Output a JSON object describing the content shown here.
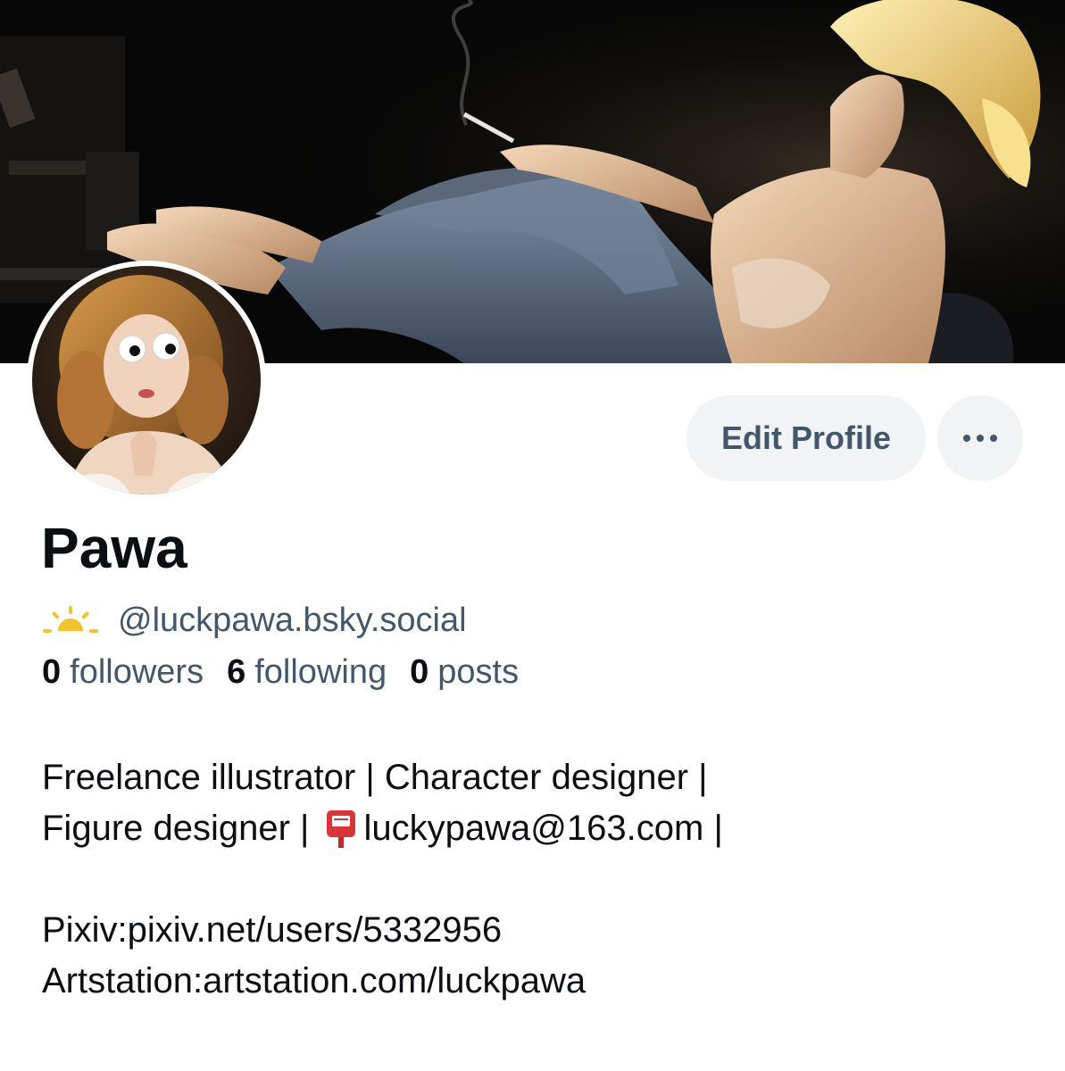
{
  "banner": {
    "icon": "anime-illustration-banner-image"
  },
  "avatar": {
    "icon": "painted-child-portrait-googly-eyes-avatar"
  },
  "actions": {
    "edit_profile_label": "Edit Profile",
    "more_icon": "ellipsis-icon"
  },
  "profile": {
    "display_name": "Pawa",
    "handle_icon": "sunrise-icon",
    "handle": "@luckpawa.bsky.social",
    "stats": {
      "followers_count": "0",
      "followers_label": "followers",
      "following_count": "6",
      "following_label": "following",
      "posts_count": "0",
      "posts_label": "posts"
    }
  },
  "bio": {
    "line1": "Freelance illustrator | Character designer |",
    "line2_before_icon": "Figure designer | ",
    "line2_icon": "postbox-icon",
    "line2_after_icon": "luckypawa@163.com |",
    "line4": "Pixiv:pixiv.net/users/5332956",
    "line5": "Artstation:artstation.com/luckpawa"
  },
  "colors": {
    "primary_text": "#0b0f14",
    "secondary_text": "#42576c",
    "button_bg": "#f1f3f5",
    "sunrise_icon": "#f2c230",
    "postbox_icon": "#d8353a"
  }
}
